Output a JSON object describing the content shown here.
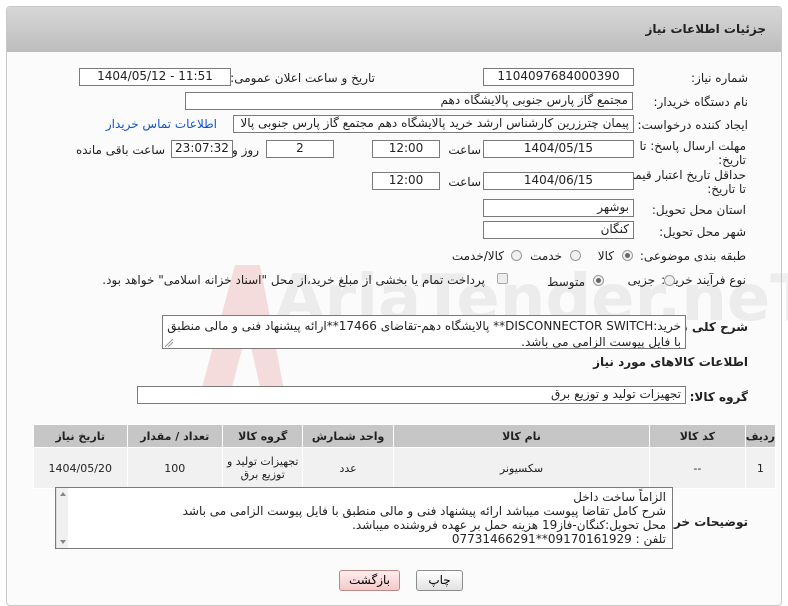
{
  "page": {
    "title": "جزئیات اطلاعات نیاز"
  },
  "fields": {
    "need_number": {
      "label": "شماره نیاز:",
      "value": "1104097684000390"
    },
    "announce_datetime": {
      "label": "تاریخ و ساعت اعلان عمومی:",
      "value": "1404/05/12 - 11:51"
    },
    "buyer_org": {
      "label": "نام دستگاه خریدار:",
      "value": "مجتمع گاز پارس جنوبی  پالایشگاه دهم"
    },
    "requester": {
      "label": "ایجاد کننده درخواست:",
      "value": "پیمان چترزرین کارشناس ارشد خرید پالایشگاه دهم مجتمع گاز پارس جنوبی  پالا",
      "contact_link": "اطلاعات تماس خریدار"
    },
    "reply_deadline": {
      "label1": "مهلت ارسال پاسخ: تا",
      "label2": "تاریخ:",
      "date": "1404/05/15",
      "time_label": "ساعت",
      "time": "12:00",
      "days": "2",
      "days_label": "روز و",
      "remaining": "23:07:32",
      "remaining_label": "ساعت باقی مانده"
    },
    "price_validity": {
      "label1": "حداقل تاریخ اعتبار قیمت:",
      "label2": "تا تاریخ:",
      "date": "1404/06/15",
      "time_label": "ساعت",
      "time": "12:00"
    },
    "province": {
      "label": "استان محل تحویل:",
      "value": "بوشهر"
    },
    "city": {
      "label": "شهر محل تحویل:",
      "value": "کنگان"
    },
    "category": {
      "label": "طبقه بندی موضوعی:",
      "options": [
        "کالا",
        "خدمت",
        "کالا/خدمت"
      ],
      "selected": "کالا"
    },
    "process": {
      "label": "نوع فرآیند خرید :",
      "options": [
        "جزیی",
        "متوسط"
      ],
      "selected": "متوسط",
      "payment_note": "پرداخت تمام یا بخشی از مبلغ خرید،از محل \"اسناد خزانه اسلامی\" خواهد بود."
    }
  },
  "description": {
    "label": "شرح کلی نیاز:",
    "text": "خرید:DISCONNECTOR SWITCH** پالایشگاه دهم-تقاضای 17466**ارائه پیشنهاد فنی و مالی منطبق با فایل پیوست الزامی می باشد."
  },
  "goods": {
    "section_title": "اطلاعات کالاهای مورد نیاز",
    "group_label": "گروه کالا:",
    "group_value": "تجهیزات تولید و توزیع برق",
    "columns": [
      "ردیف",
      "کد کالا",
      "نام کالا",
      "واحد شمارش",
      "گروه کالا",
      "تعداد / مقدار",
      "تاریخ نیاز"
    ],
    "rows": [
      [
        "1",
        "--",
        "سکسیونر",
        "عدد",
        "تجهیزات تولید و توزیع برق",
        "100",
        "1404/05/20"
      ]
    ]
  },
  "buyer_notes": {
    "label": "توضیحات خریدار:",
    "lines": [
      "الزاماً ساخت داخل",
      "شرح کامل تقاضا پیوست میباشد ارائه پیشنهاد فنی و مالی منطبق با فایل پیوست الزامی می باشد",
      "محل تحویل:کنگان-فاز19 هزینه حمل بر عهده فروشنده میباشد.",
      "تلفن : 09170161929**07731466291"
    ]
  },
  "buttons": {
    "print": "چاپ",
    "back": "بازگشت"
  },
  "watermark": {
    "text": "AriaTender.neT"
  }
}
